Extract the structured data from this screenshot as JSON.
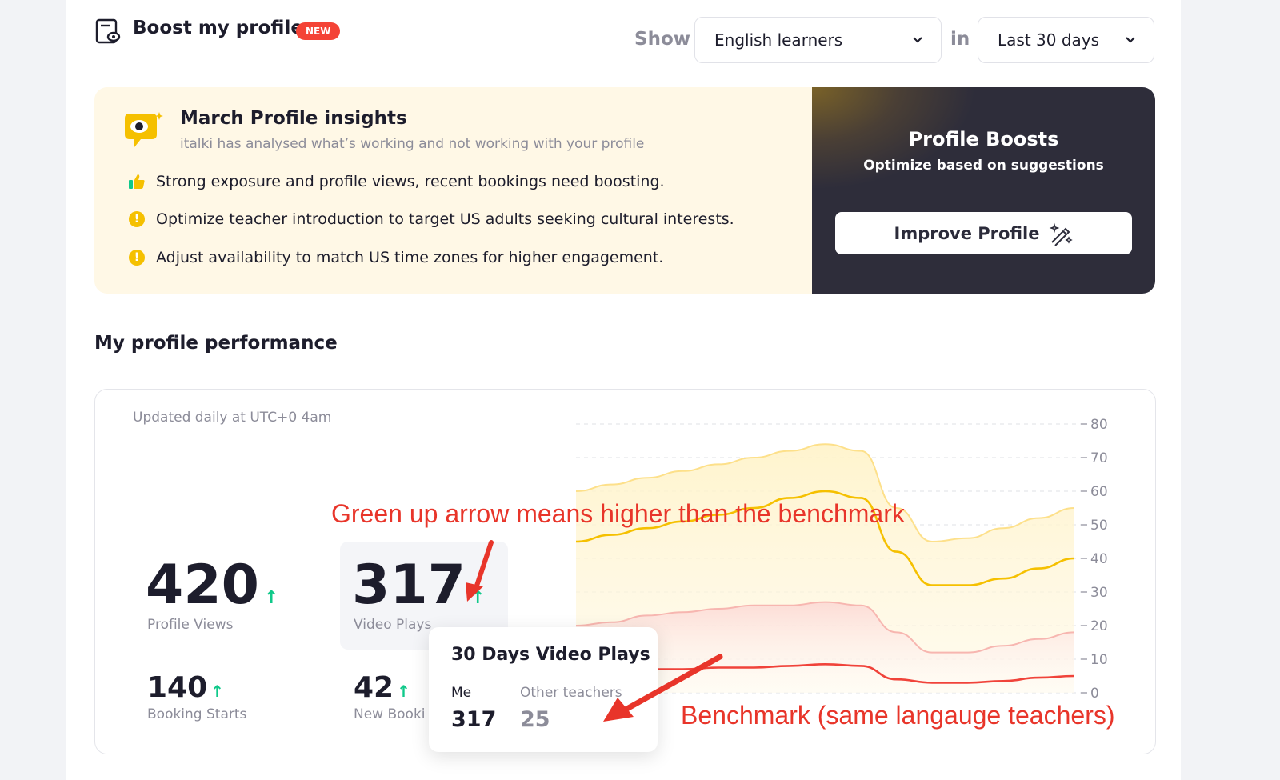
{
  "header": {
    "title": "Boost my profile",
    "badge": "NEW",
    "show_label": "Show",
    "audience_select": "English learners",
    "in_label": "in",
    "period_select": "Last 30 days"
  },
  "insights": {
    "title": "March Profile insights",
    "subtitle": "italki has analysed what’s working and not working with your profile",
    "items": [
      {
        "icon": "thumbs-up-icon",
        "text": "Strong exposure and profile views, recent bookings need boosting."
      },
      {
        "icon": "warning-icon",
        "text": "Optimize teacher introduction to target US adults seeking cultural interests."
      },
      {
        "icon": "warning-icon",
        "text": "Adjust availability to match US time zones for higher engagement."
      }
    ]
  },
  "boosts": {
    "title": "Profile Boosts",
    "subtitle": "Optimize based on suggestions",
    "button": "Improve Profile"
  },
  "performance": {
    "title": "My profile performance",
    "updated": "Updated daily at UTC+0 4am",
    "stats": {
      "profile_views": {
        "value": "420",
        "label": "Profile Views"
      },
      "video_plays": {
        "value": "317",
        "label": "Video Plays"
      },
      "booking_starts": {
        "value": "140",
        "label": "Booking Starts"
      },
      "new_bookings": {
        "value": "42",
        "label": "New Booki"
      }
    },
    "tooltip": {
      "title": "30 Days Video Plays",
      "me_label": "Me",
      "me_value": "317",
      "other_label": "Other teachers",
      "other_value": "25"
    }
  },
  "annotations": {
    "green_arrow": "Green up arrow means higher than the benchmark",
    "benchmark": "Benchmark (same langauge teachers)"
  },
  "colors": {
    "accent_red": "#f44336",
    "up_green": "#10c98a",
    "series_yellow": "#f5c000",
    "series_red": "#f0433a",
    "annotation_red": "#e8352a"
  },
  "chart_data": {
    "type": "area",
    "x": [
      0,
      1,
      2,
      3,
      4,
      5,
      6,
      7,
      8,
      9,
      10,
      11,
      12,
      13,
      14
    ],
    "yticks": [
      0,
      10,
      20,
      30,
      40,
      50,
      60,
      70,
      80
    ],
    "ylim": [
      0,
      80
    ],
    "grid": true,
    "series": [
      {
        "name": "",
        "color": "#fde08a",
        "values": [
          60,
          62,
          64,
          66,
          68,
          70,
          72,
          74,
          72,
          55,
          45,
          46,
          49,
          52,
          55
        ]
      },
      {
        "name": "",
        "color": "#f5c000",
        "values": [
          45,
          47,
          49,
          51,
          53,
          55,
          58,
          60,
          58,
          42,
          32,
          32,
          34,
          37,
          40
        ]
      },
      {
        "name": "",
        "color": "#f7b6b0",
        "values": [
          20,
          21,
          23,
          24,
          25,
          26,
          26,
          27,
          26,
          18,
          12,
          12,
          14,
          16,
          18
        ]
      },
      {
        "name": "",
        "color": "#f0433a",
        "values": [
          6,
          6,
          7,
          7,
          7.5,
          7.5,
          8,
          8.5,
          8,
          4,
          3,
          3,
          3.5,
          4.5,
          5
        ]
      }
    ]
  }
}
